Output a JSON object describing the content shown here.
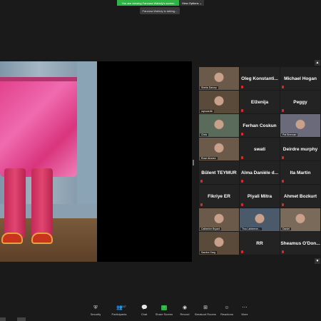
{
  "banner": {
    "viewing_text": "You are viewing Farzana Wahidy's screen",
    "options_label": "View Options ⌄"
  },
  "talking": "Farzana Wahidy is talking...",
  "participants": [
    {
      "name": "Sheila Darcey",
      "video": true
    },
    {
      "name": "Oleg Konstanti...",
      "video": false
    },
    {
      "name": "Michael Hogan",
      "video": false
    },
    {
      "name": "rapscardin",
      "video": true
    },
    {
      "name": "Elženija",
      "video": false
    },
    {
      "name": "Peggy",
      "video": false
    },
    {
      "name": "Chris",
      "video": true
    },
    {
      "name": "Ferhan Coskun",
      "video": false
    },
    {
      "name": "Pat Brennan",
      "video": true
    },
    {
      "name": "Rose Alvarez",
      "video": true
    },
    {
      "name": "swati",
      "video": false
    },
    {
      "name": "Deirdre murphy",
      "video": false
    },
    {
      "name": "Bülent TEYMUR",
      "video": false
    },
    {
      "name": "Alma Danièle d...",
      "video": false
    },
    {
      "name": "Ita Martin",
      "video": false
    },
    {
      "name": "Fikriye ER",
      "video": false
    },
    {
      "name": "Piyali Mitra",
      "video": false
    },
    {
      "name": "Ahmet Bozkurt",
      "video": false
    },
    {
      "name": "Catherine Bryant",
      "video": true
    },
    {
      "name": "Tina Lahteenm...",
      "video": true
    },
    {
      "name": "Daniel",
      "video": true
    },
    {
      "name": "Sandra Garg",
      "video": true
    },
    {
      "name": "RR",
      "video": false
    },
    {
      "name": "Sheamus O'Don...",
      "video": false
    }
  ],
  "toolbar": {
    "security": "Security",
    "participants": "Participants",
    "participant_count": "247",
    "chat": "Chat",
    "share_screen": "Share Screen",
    "record": "Record",
    "breakout_rooms": "Breakout Rooms",
    "reactions": "Reactions",
    "more": "More"
  },
  "colors": {
    "share_green": "#2fb344",
    "mic_red": "#e02828",
    "tile_bg": "#232323"
  }
}
